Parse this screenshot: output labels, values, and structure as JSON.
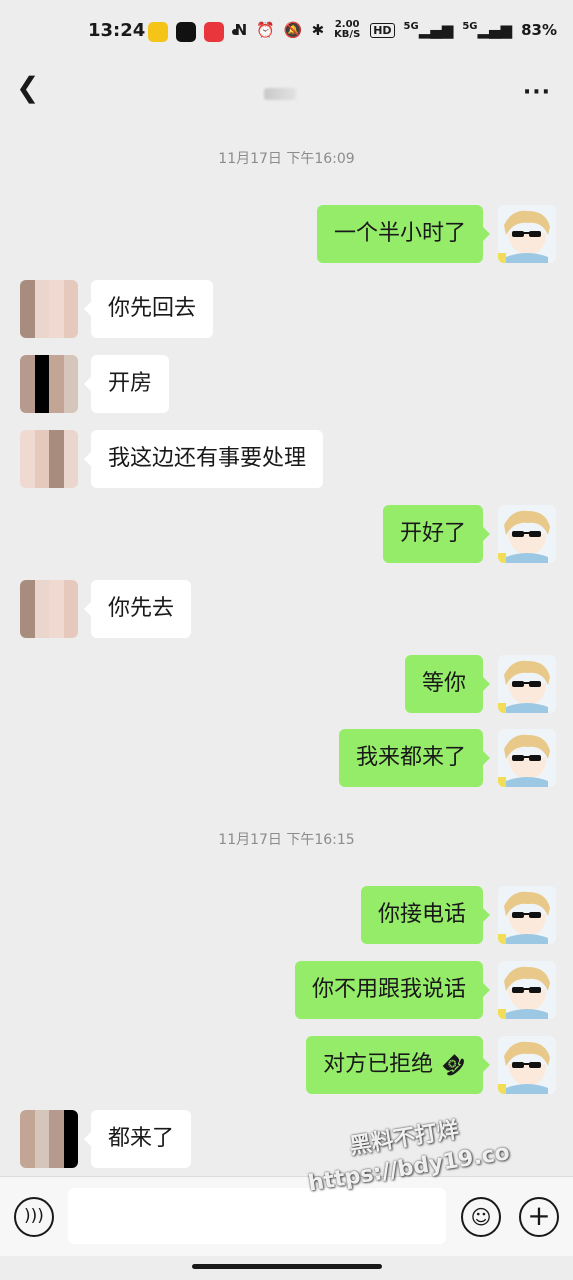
{
  "status_bar": {
    "time": "13:24",
    "network_speed": "2.00\nKB/S",
    "hd_label": "HD",
    "signal1": "5G",
    "signal2": "5G",
    "battery": "83%"
  },
  "header": {
    "back_icon": "chevron-left-icon",
    "more_icon": "more-dots-icon"
  },
  "messages": [
    {
      "type": "timestamp",
      "text": "11月17日 下午16:09"
    },
    {
      "type": "msg",
      "side": "mine",
      "text": "一个半小时了"
    },
    {
      "type": "msg",
      "side": "theirs",
      "text": "你先回去"
    },
    {
      "type": "msg",
      "side": "theirs",
      "text": "开房"
    },
    {
      "type": "msg",
      "side": "theirs",
      "text": "我这边还有事要处理"
    },
    {
      "type": "msg",
      "side": "mine",
      "text": "开好了"
    },
    {
      "type": "msg",
      "side": "theirs",
      "text": "你先去"
    },
    {
      "type": "msg",
      "side": "mine",
      "text": "等你"
    },
    {
      "type": "msg",
      "side": "mine",
      "text": "我来都来了"
    },
    {
      "type": "timestamp",
      "text": "11月17日 下午16:15"
    },
    {
      "type": "msg",
      "side": "mine",
      "text": "你接电话"
    },
    {
      "type": "msg",
      "side": "mine",
      "text": "你不用跟我说话"
    },
    {
      "type": "msg",
      "side": "mine",
      "text": "对方已拒绝",
      "icon": "hangup-icon"
    },
    {
      "type": "msg",
      "side": "theirs",
      "text": "都来了"
    }
  ],
  "input_bar": {
    "voice_icon": "voice-icon",
    "emoji_icon": "emoji-icon",
    "plus_icon": "plus-icon",
    "input_value": ""
  },
  "watermark": {
    "line1": "黑料不打烊",
    "line2": "https://bdy19.co"
  },
  "colors": {
    "background": "#ededed",
    "mine_bubble": "#95ec69",
    "theirs_bubble": "#ffffff"
  }
}
